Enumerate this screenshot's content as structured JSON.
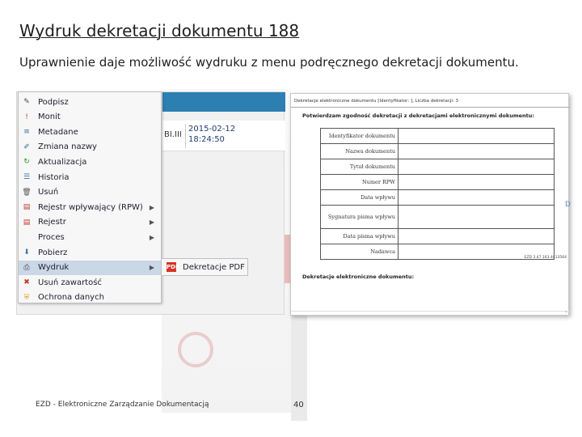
{
  "slide": {
    "title": "Wydruk dekretacji dokumentu 188",
    "subtitle": "Uprawnienie daje możliwość wydruku z menu podręcznego dekretacji dokumentu."
  },
  "app_row": {
    "id": "BI.III",
    "date": "2015-02-12",
    "time": "18:24:50"
  },
  "context_menu": {
    "items": [
      {
        "label": "Podpisz",
        "icon": "sign-icon"
      },
      {
        "label": "Monit",
        "icon": "alert-icon"
      },
      {
        "label": "Metadane",
        "icon": "metadata-icon"
      },
      {
        "label": "Zmiana nazwy",
        "icon": "rename-icon"
      },
      {
        "label": "Aktualizacja",
        "icon": "refresh-icon"
      },
      {
        "label": "Historia",
        "icon": "history-icon"
      },
      {
        "label": "Usuń",
        "icon": "trash-icon"
      },
      {
        "label": "Rejestr wpływający (RPW)",
        "icon": "register-icon",
        "submenu": true
      },
      {
        "label": "Rejestr",
        "icon": "register-icon",
        "submenu": true
      },
      {
        "label": "Proces",
        "icon": "",
        "submenu": true
      },
      {
        "label": "Pobierz",
        "icon": "download-icon"
      },
      {
        "label": "Wydruk",
        "icon": "print-icon",
        "submenu": true,
        "active": true
      },
      {
        "label": "Usuń zawartość",
        "icon": "clear-content-icon"
      },
      {
        "label": "Ochrona danych",
        "icon": "shield-icon"
      }
    ]
  },
  "submenu": {
    "label": "Dekretacje PDF",
    "icon": "pdf-icon"
  },
  "document": {
    "header": "Dekretacje elektroniczne dokumentu [Identyfikator: ], Liczba dekretacji: 3",
    "confirm": "Potwierdzam zgodność dekretacji z dekretacjami elektronicznymi dokumentu:",
    "rows": [
      {
        "key": "Identyfikator dokumentu"
      },
      {
        "key": "Nazwa dokumentu"
      },
      {
        "key": "Tytuł dokumentu"
      },
      {
        "key": "Numer RPW"
      },
      {
        "key": "Data wpływu"
      },
      {
        "key": "Sygnatura pisma wpływu",
        "tall": true
      },
      {
        "key": "Data pisma wpływu"
      },
      {
        "key": "Nadawca"
      }
    ],
    "ezd_ref": "EZD 3.47.163.4413564",
    "section_title": "Dekretacje elektroniczne dokumentu:"
  },
  "footer": {
    "left": "EZD - Elektroniczne Zarządzanie Dokumentacją",
    "page": "40"
  }
}
